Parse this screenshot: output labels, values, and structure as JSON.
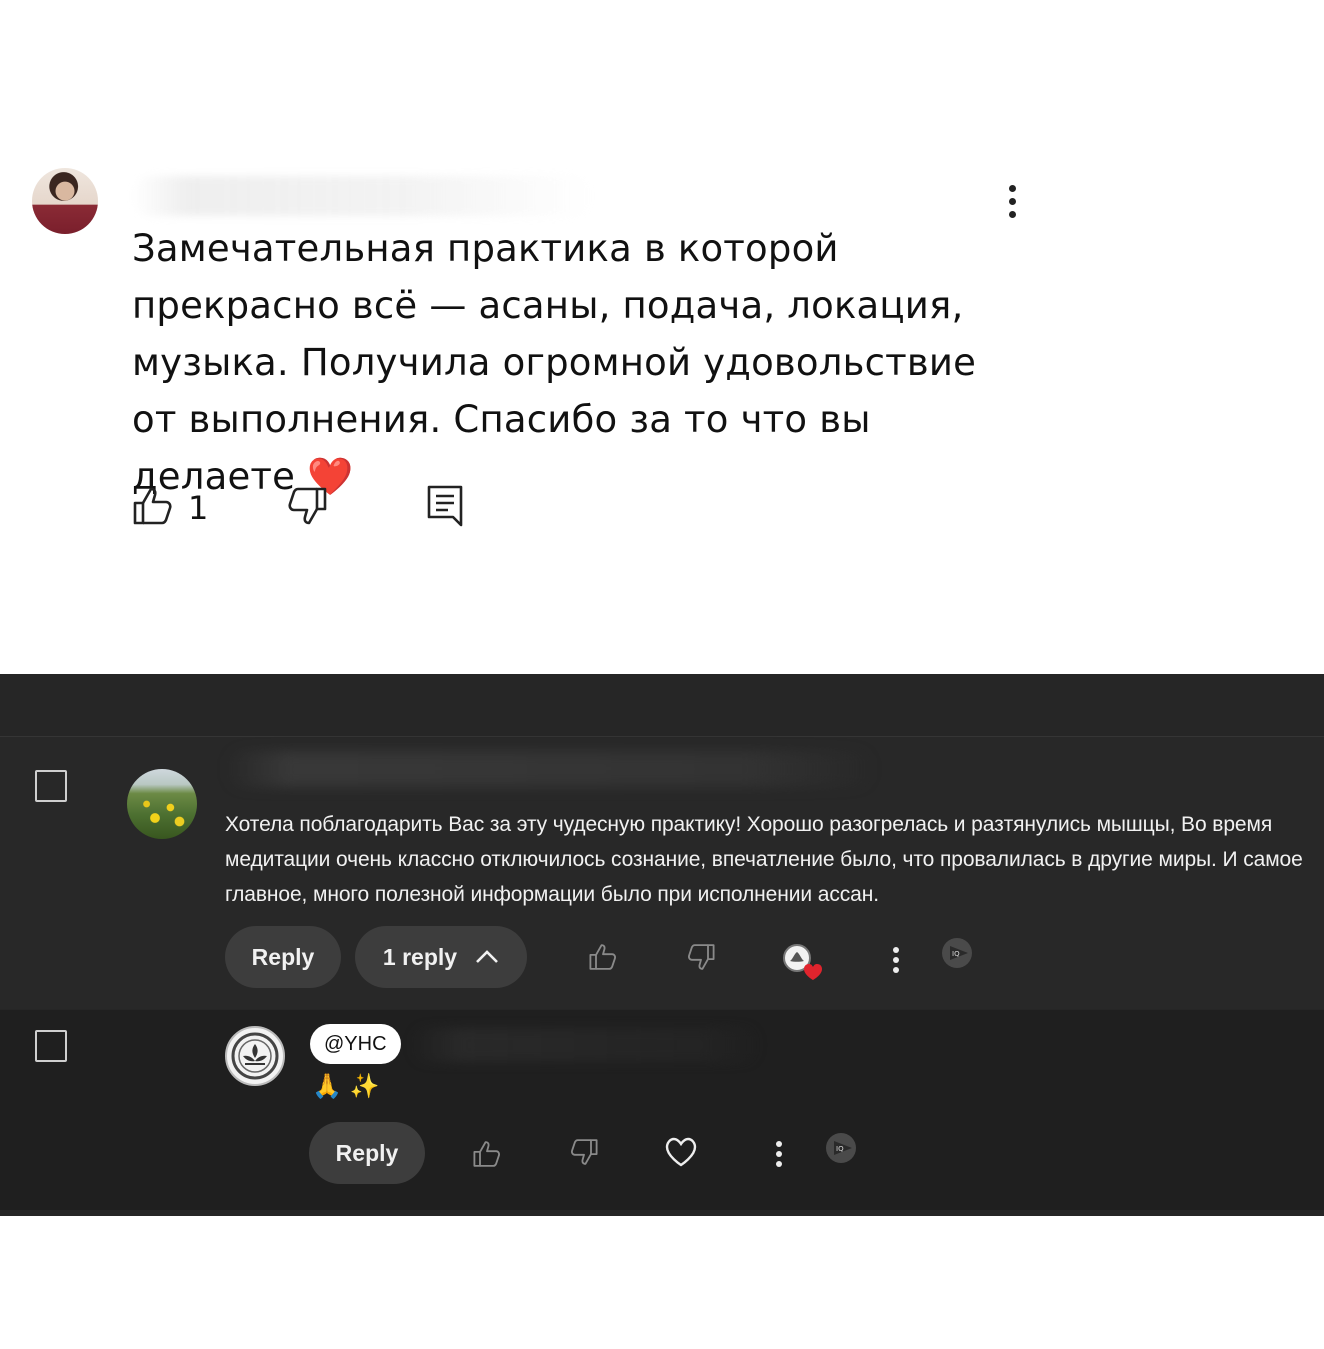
{
  "light_comment": {
    "text": "Замечательная практика в которой прекрасно всё — асаны, подача, локация, музыка. Получила огромной удовольствие от выполнения. Спасибо за то что вы делаете",
    "emoji": "❤️",
    "like_count": "1",
    "icons": [
      "thumb-up-icon",
      "thumb-down-icon",
      "reply-comment-icon",
      "more-vert-icon"
    ]
  },
  "dark_thread": {
    "comment": {
      "text": "Хотела поблагодарить Вас за эту чудесную практику!  Хорошо разогрелась и разтянулись мышцы, Во время медитации  очень классно отключилось сознание, впечатление было, что провалилась в другие миры. И самое главное, много полезной информации было при исполнении ассан.",
      "reply_label": "Reply",
      "replies_label": "1 reply"
    },
    "reply": {
      "handle": "@YHC",
      "text": "🙏 ✨",
      "reply_label": "Reply"
    }
  },
  "colors": {
    "dark_bg": "#262626",
    "pill_bg": "#3d3d3d",
    "heart": "#e0242d",
    "text_light": "#f1f1f1"
  }
}
